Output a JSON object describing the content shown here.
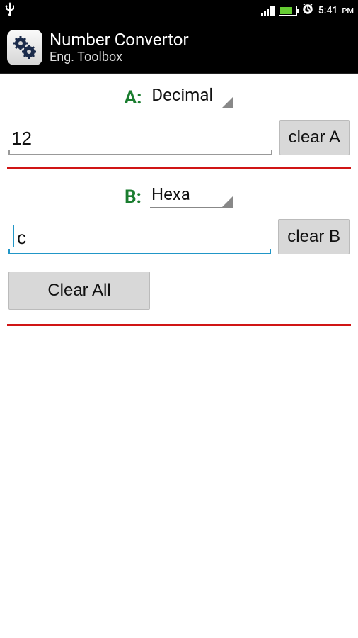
{
  "status": {
    "time": "5:41",
    "ampm": "PM"
  },
  "app": {
    "title": "Number Convertor",
    "subtitle": "Eng. Toolbox"
  },
  "sectionA": {
    "label": "A:",
    "type": "Decimal",
    "value": "12",
    "clear_label": "clear A"
  },
  "sectionB": {
    "label": "B:",
    "type": "Hexa",
    "value": "c",
    "clear_label": "clear B"
  },
  "clear_all_label": "Clear All"
}
